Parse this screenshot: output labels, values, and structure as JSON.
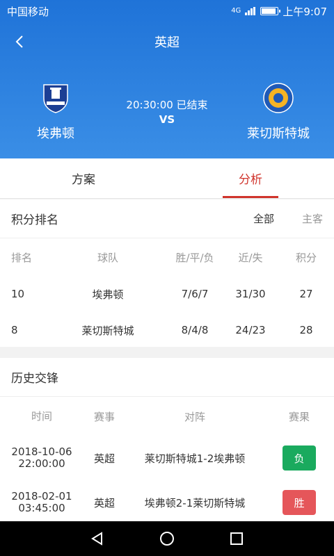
{
  "statusbar": {
    "carrier": "中国移动",
    "signal": "4G",
    "time": "上午9:07",
    "battery_level": 0.9
  },
  "header": {
    "title": "英超"
  },
  "match": {
    "home": {
      "name": "埃弗顿",
      "crest": "everton-crest-icon"
    },
    "away": {
      "name": "莱切斯特城",
      "crest": "leicester-crest-icon"
    },
    "status": "20:30:00 已结束",
    "vs": "VS"
  },
  "tabs": [
    {
      "label": "方案"
    },
    {
      "label": "分析"
    }
  ],
  "standings": {
    "title": "积分排名",
    "filters": [
      "全部",
      "主客"
    ],
    "headers": {
      "rank": "排名",
      "team": "球队",
      "wdl": "胜/平/负",
      "gf_ga": "近/失",
      "pts": "积分"
    },
    "rows": [
      {
        "rank": "10",
        "team": "埃弗顿",
        "wdl": "7/6/7",
        "gf_ga": "31/30",
        "pts": "27"
      },
      {
        "rank": "8",
        "team": "莱切斯特城",
        "wdl": "8/4/8",
        "gf_ga": "24/23",
        "pts": "28"
      }
    ]
  },
  "history": {
    "title": "历史交锋",
    "headers": {
      "time": "时间",
      "comp": "赛事",
      "match": "对阵",
      "result": "赛果"
    },
    "rows": [
      {
        "date": "2018-10-06",
        "clock": "22:00:00",
        "comp": "英超",
        "match": "莱切斯特城1-2埃弗顿",
        "result": "负",
        "color": "#1aaa5e"
      },
      {
        "date": "2018-02-01",
        "clock": "03:45:00",
        "comp": "英超",
        "match": "埃弗顿2-1莱切斯特城",
        "result": "胜",
        "color": "#e5565a"
      }
    ]
  },
  "colors": {
    "primary": "#1f73d8",
    "accent": "#d0342c"
  },
  "system_nav": {
    "back": "back-triangle-icon",
    "home": "home-circle-icon",
    "recents": "recents-square-icon"
  }
}
